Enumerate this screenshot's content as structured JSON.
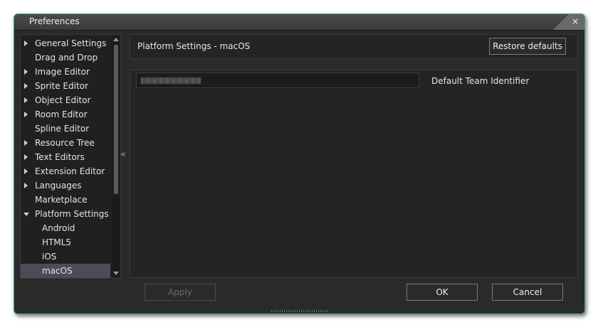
{
  "window": {
    "title": "Preferences",
    "close_glyph": "×",
    "accent": "#3fa784"
  },
  "tree": {
    "items": [
      {
        "label": "General Settings",
        "expandable": true,
        "expanded": false,
        "level": 0
      },
      {
        "label": "Drag and Drop",
        "expandable": false,
        "level": 0
      },
      {
        "label": "Image Editor",
        "expandable": true,
        "expanded": false,
        "level": 0
      },
      {
        "label": "Sprite Editor",
        "expandable": true,
        "expanded": false,
        "level": 0
      },
      {
        "label": "Object Editor",
        "expandable": true,
        "expanded": false,
        "level": 0
      },
      {
        "label": "Room Editor",
        "expandable": true,
        "expanded": false,
        "level": 0
      },
      {
        "label": "Spline Editor",
        "expandable": false,
        "level": 0
      },
      {
        "label": "Resource Tree",
        "expandable": true,
        "expanded": false,
        "level": 0
      },
      {
        "label": "Text Editors",
        "expandable": true,
        "expanded": false,
        "level": 0
      },
      {
        "label": "Extension Editor",
        "expandable": true,
        "expanded": false,
        "level": 0
      },
      {
        "label": "Languages",
        "expandable": true,
        "expanded": false,
        "level": 0
      },
      {
        "label": "Marketplace",
        "expandable": false,
        "level": 0
      },
      {
        "label": "Platform Settings",
        "expandable": true,
        "expanded": true,
        "level": 0
      },
      {
        "label": "Android",
        "expandable": false,
        "level": 1
      },
      {
        "label": "HTML5",
        "expandable": false,
        "level": 1
      },
      {
        "label": "iOS",
        "expandable": false,
        "level": 1
      },
      {
        "label": "macOS",
        "expandable": false,
        "level": 1,
        "selected": true
      }
    ],
    "collapse_glyph": "«"
  },
  "panel": {
    "title": "Platform Settings - macOS",
    "restore_label": "Restore defaults",
    "team_identifier_label": "Default Team Identifier"
  },
  "footer": {
    "apply_label": "Apply",
    "ok_label": "OK",
    "cancel_label": "Cancel"
  }
}
